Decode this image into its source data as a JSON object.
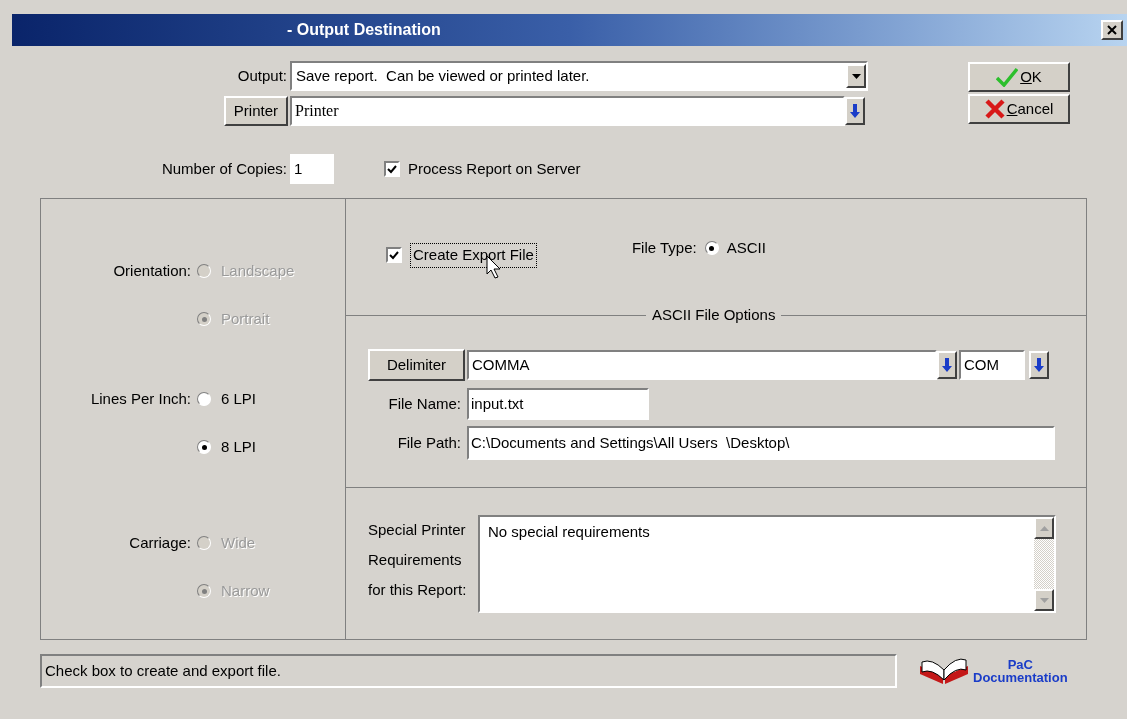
{
  "window": {
    "title": "- Output Destination"
  },
  "output": {
    "label": "Output:",
    "value": "Save report.  Can be viewed or printed later."
  },
  "printer": {
    "button": "Printer",
    "value": "Printer"
  },
  "copies": {
    "label": "Number of Copies:",
    "value": "1"
  },
  "process_on_server": {
    "label": "Process Report on Server",
    "checked": true
  },
  "buttons": [
    {
      "kind": "ok",
      "label": "OK"
    },
    {
      "kind": "cancel",
      "label": "Cancel"
    }
  ],
  "option_groups": [
    {
      "label": "Orientation:",
      "disabled": true,
      "options": [
        {
          "label": "Landscape",
          "selected": false
        },
        {
          "label": "Portrait",
          "selected": true
        }
      ]
    },
    {
      "label": "Lines Per Inch:",
      "disabled": false,
      "options": [
        {
          "label": "6 LPI",
          "selected": false
        },
        {
          "label": "8 LPI",
          "selected": true
        }
      ]
    },
    {
      "label": "Carriage:",
      "disabled": true,
      "options": [
        {
          "label": "Wide",
          "selected": false
        },
        {
          "label": "Narrow",
          "selected": true
        }
      ]
    }
  ],
  "export": {
    "label": "Create Export File",
    "checked": true,
    "focused": true
  },
  "file_type": {
    "label": "File Type:",
    "options": [
      {
        "label": "ASCII",
        "selected": true
      }
    ]
  },
  "ascii_options": {
    "title": "ASCII File Options",
    "delimiter_button": "Delimiter",
    "delimiter": "COMMA",
    "delimiter_code": "COM",
    "file_name_label": "File Name:",
    "file_name": "input.txt",
    "file_path_label": "File Path:",
    "file_path": "C:\\Documents and Settings\\All Users  \\Desktop\\"
  },
  "requirements": {
    "label": "Special Printer Requirements for this Report:",
    "value": "No special requirements"
  },
  "status": "Check box to create and export file.",
  "documentation": {
    "line1": "PaC",
    "line2": "Documentation"
  }
}
